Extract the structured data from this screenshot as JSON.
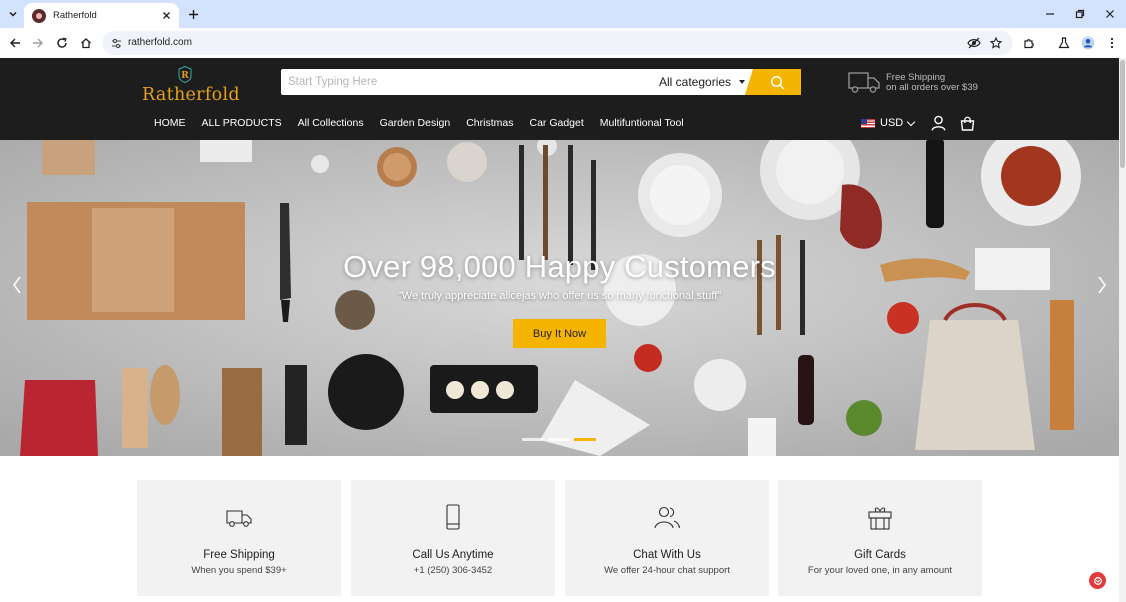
{
  "browser": {
    "tab_title": "Ratherfold",
    "url": "ratherfold.com"
  },
  "site": {
    "logo_text": "Ratherfold",
    "search": {
      "placeholder": "Start Typing Here",
      "category": "All categories"
    },
    "shipping": {
      "line1": "Free Shipping",
      "line2": "on all orders over $39"
    },
    "nav": [
      "HOME",
      "ALL PRODUCTS",
      "All Collections",
      "Garden Design",
      "Christmas",
      "Car Gadget",
      "Multifuntional Tool"
    ],
    "currency": "USD"
  },
  "hero": {
    "title": "Over 98,000 Happy Customers",
    "subtitle": "\"We truly appreciate alicejas who offer us so many functional stuff\"",
    "cta": "Buy It Now",
    "slides_total": 3,
    "slide_active": 3
  },
  "features": [
    {
      "title": "Free Shipping",
      "subtitle": "When you spend $39+",
      "icon": "truck-icon"
    },
    {
      "title": "Call Us Anytime",
      "subtitle": "+1 (250) 306-3452",
      "icon": "phone-icon"
    },
    {
      "title": "Chat With Us",
      "subtitle": "We offer 24-hour chat support",
      "icon": "users-icon"
    },
    {
      "title": "Gift Cards",
      "subtitle": "For your loved one, in any amount",
      "icon": "gift-icon"
    }
  ],
  "colors": {
    "accent": "#f5b400",
    "header_bg": "#1d1d1d",
    "logo": "#e6a01b",
    "browser_tabstrip": "#d3e3fd"
  }
}
